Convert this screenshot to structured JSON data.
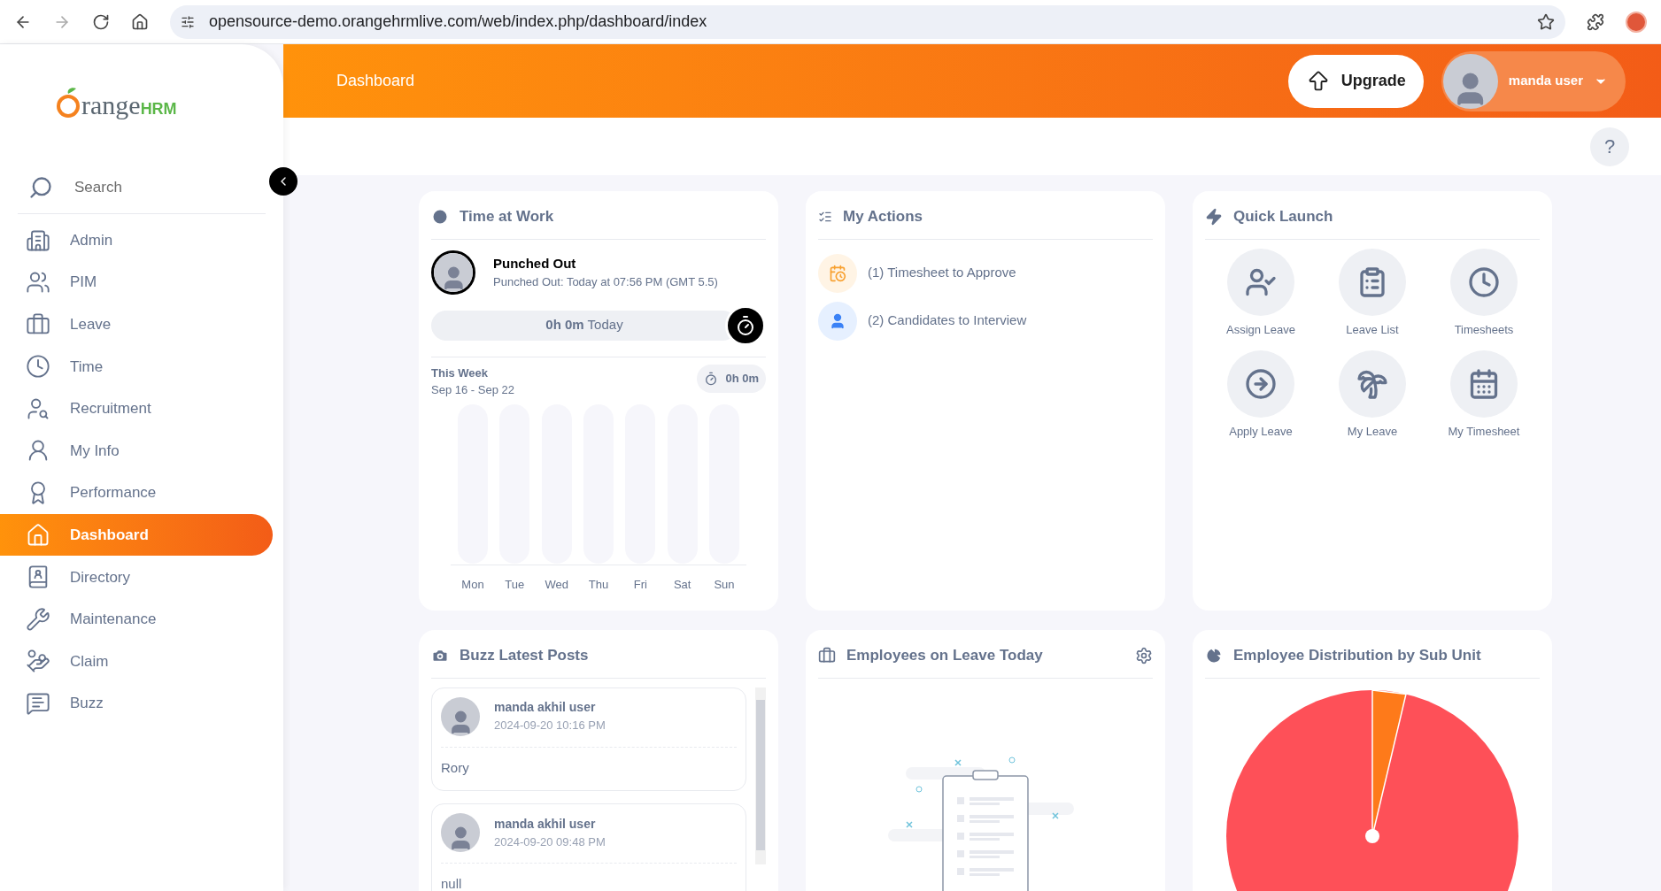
{
  "browser": {
    "url": "opensource-demo.orangehrmlive.com/web/index.php/dashboard/index"
  },
  "brand": {
    "name": "range",
    "suffix": "HRM"
  },
  "sidebar": {
    "search_placeholder": "Search",
    "items": [
      {
        "label": "Admin",
        "selected": false
      },
      {
        "label": "PIM",
        "selected": false
      },
      {
        "label": "Leave",
        "selected": false
      },
      {
        "label": "Time",
        "selected": false
      },
      {
        "label": "Recruitment",
        "selected": false
      },
      {
        "label": "My Info",
        "selected": false
      },
      {
        "label": "Performance",
        "selected": false
      },
      {
        "label": "Dashboard",
        "selected": true
      },
      {
        "label": "Directory",
        "selected": false
      },
      {
        "label": "Maintenance",
        "selected": false
      },
      {
        "label": "Claim",
        "selected": false
      },
      {
        "label": "Buzz",
        "selected": false
      }
    ]
  },
  "header": {
    "title": "Dashboard",
    "upgrade": "Upgrade",
    "user": "manda user",
    "help": "?"
  },
  "time_at_work": {
    "title": "Time at Work",
    "status": "Punched Out",
    "detail": "Punched Out: Today at 07:56 PM (GMT 5.5)",
    "today_hours": "0h 0m",
    "today_label": "Today",
    "week_label": "This Week",
    "week_range": "Sep 16 - Sep 22",
    "week_total": "0h 0m",
    "days": [
      "Mon",
      "Tue",
      "Wed",
      "Thu",
      "Fri",
      "Sat",
      "Sun"
    ]
  },
  "my_actions": {
    "title": "My Actions",
    "items": [
      "(1) Timesheet to Approve",
      "(2) Candidates to Interview"
    ]
  },
  "quick_launch": {
    "title": "Quick Launch",
    "items": [
      "Assign Leave",
      "Leave List",
      "Timesheets",
      "Apply Leave",
      "My Leave",
      "My Timesheet"
    ]
  },
  "buzz": {
    "title": "Buzz Latest Posts",
    "posts": [
      {
        "author": "manda akhil user",
        "time": "2024-09-20 10:16 PM",
        "text": "Rory"
      },
      {
        "author": "manda akhil user",
        "time": "2024-09-20 09:48 PM",
        "text": "null"
      }
    ]
  },
  "leave_today": {
    "title": "Employees on Leave Today"
  },
  "distribution": {
    "title": "Employee Distribution by Sub Unit"
  }
}
